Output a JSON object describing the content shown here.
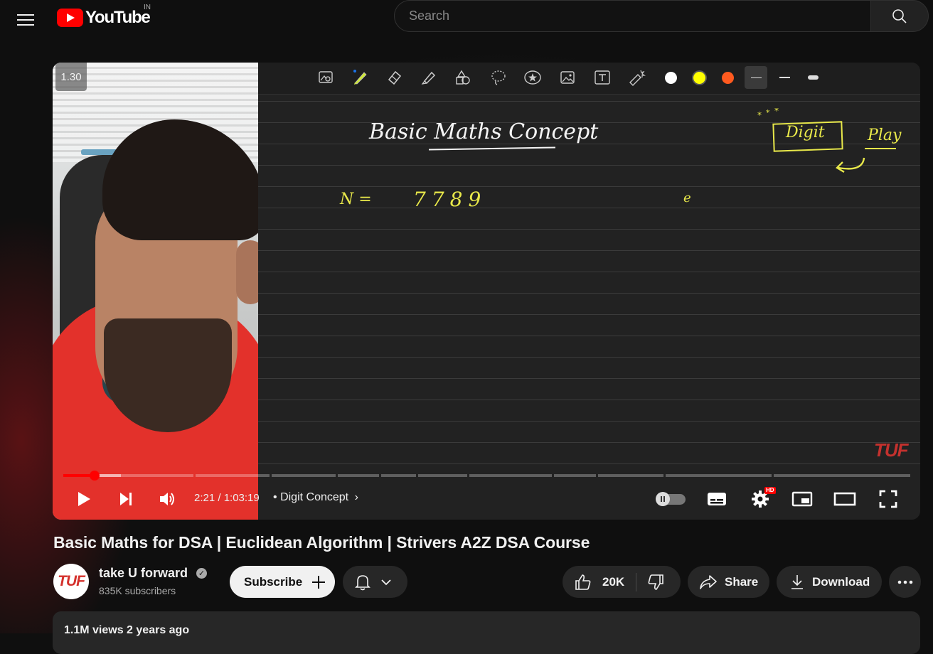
{
  "masthead": {
    "logo_text": "YouTube",
    "country_code": "IN",
    "search_placeholder": "Search"
  },
  "player": {
    "speed_badge": "1.30",
    "watermark": "TUF",
    "current_time": "2:21",
    "duration": "1:03:19",
    "time_display": "2:21 / 1:03:19",
    "chapter_separator": "•",
    "chapter_title": "Digit Concept",
    "progress_fraction": 0.037,
    "settings_badge": "HD",
    "board_colors": {
      "white": "#ffffff",
      "yellow": "#ffff00",
      "orange": "#ff5a1f"
    },
    "board_writing": {
      "heading": "Basic Maths Concept",
      "line1_label": "N =",
      "line1_value": "7789",
      "stray_mark": "e",
      "corner_word1": "Digit",
      "corner_word2": "Play"
    }
  },
  "video": {
    "title": "Basic Maths for DSA | Euclidean Algorithm | Strivers A2Z DSA Course",
    "channel_name": "take U forward",
    "channel_logo_text": "TUF",
    "subscribers": "835K subscribers",
    "subscribe_label": "Subscribe",
    "likes": "20K",
    "share_label": "Share",
    "download_label": "Download",
    "views_info": "1.1M views  2 years ago"
  },
  "colors": {
    "accent_red": "#ff0000",
    "background": "#0f0f0f",
    "pill_bg": "#272727"
  }
}
